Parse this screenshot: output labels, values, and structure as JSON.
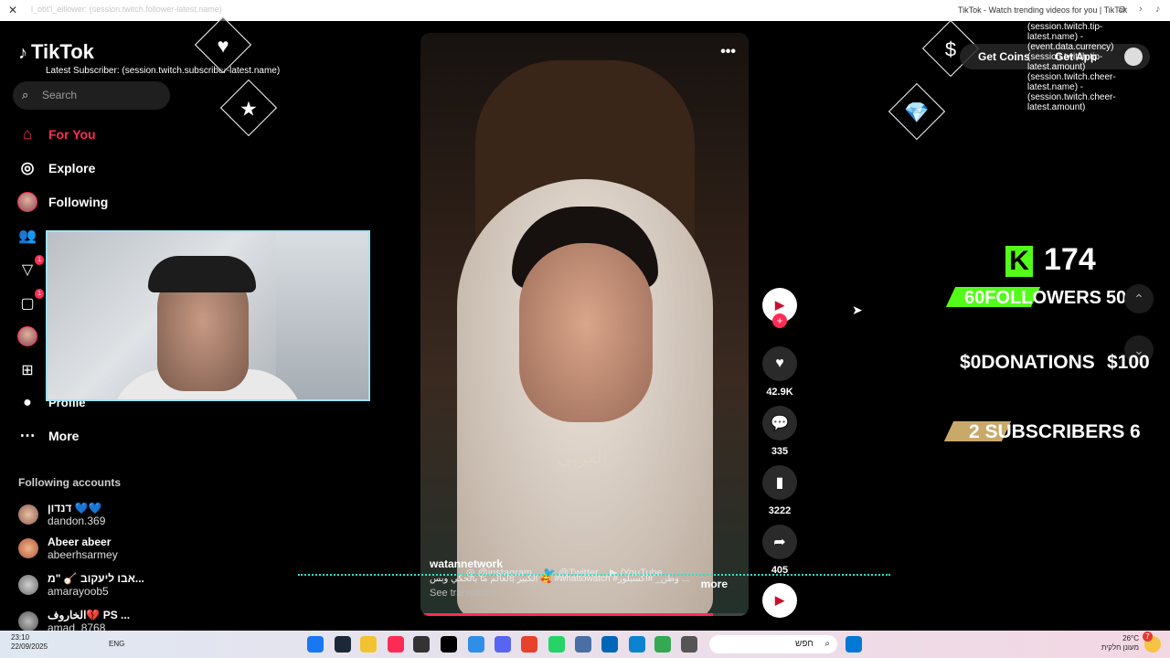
{
  "browser": {
    "faded_url_text": "l_obt'l_eillower: (session.twitch.follower-latest.name)",
    "window_title": "TikTok - Watch trending videos for you | TikTok"
  },
  "sidebar": {
    "logo": "TikTok",
    "subscriber_overlay": "Latest Subscriber: (session.twitch.subscriber-latest.name)",
    "search_placeholder": "Search",
    "nav": [
      {
        "label": "For You",
        "icon": "home-icon",
        "active": true
      },
      {
        "label": "Explore",
        "icon": "compass-icon"
      },
      {
        "label": "Following",
        "icon": "following-avatar-icon"
      },
      {
        "label": "More",
        "icon": "more-icon"
      }
    ],
    "partial_label": "Profile",
    "badges": {
      "activity": "1",
      "messages": "1"
    },
    "following_header": "Following accounts",
    "accounts": [
      {
        "name": "דנדון 💙💙",
        "handle": "dandon.369"
      },
      {
        "name": "Abeer abeer",
        "handle": "abeerhsarmey"
      },
      {
        "name": "אבו ליעקוב 🪕 \"מ...",
        "handle": "amarayoob5"
      },
      {
        "name": "الخاروف💔 PS ...",
        "handle": "amad_8768"
      }
    ]
  },
  "video": {
    "author": "watannetwork",
    "caption": "الكبير بالعالم ما بالحكي وبس 🥰 #whattowatch #وطن_ #اكسبلور ...",
    "more_label": "more",
    "see_translation": "See translation",
    "social_links": {
      "instagram": "@instagram",
      "twitter": "@Twitter",
      "youtube": "/YouTube"
    },
    "progress": 0.89,
    "watermark": "العربي"
  },
  "actions": {
    "likes": "42.9K",
    "comments": "335",
    "saves": "3222",
    "shares": "405"
  },
  "stream_overlay": {
    "tip_text": "(session.twitch.tip-latest.name) - (event.data.currency) (session.twitch.tip-latest.amount) (session.twitch.cheer-latest.name) - (session.twitch.cheer-latest.amount)",
    "get_coins": "Get Coins",
    "get_app": "Get App",
    "kick_count": "174",
    "followers_label": "FOLLOWERS",
    "followers_left": "60",
    "followers_right": "50",
    "followers_fill": 0.6,
    "donations_label": "$0DONATIONS",
    "donations_right": "$100",
    "subscribers_label": "2 SUBSCRIBERS",
    "subscribers_right": "6",
    "subscribers_fill": 0.33,
    "green": "#53fc18",
    "gold": "#c9a96a"
  },
  "taskbar": {
    "time": "23:10",
    "date": "22/09/2025",
    "lang": "ENG",
    "search_placeholder": "חפש",
    "temperature": "26°C",
    "weather": "מעונן חלקית",
    "notif_count": "7"
  },
  "colors": {
    "accent": "#fe2c55",
    "teal": "#32e0c4",
    "cam_border": "#9ee3f2"
  }
}
